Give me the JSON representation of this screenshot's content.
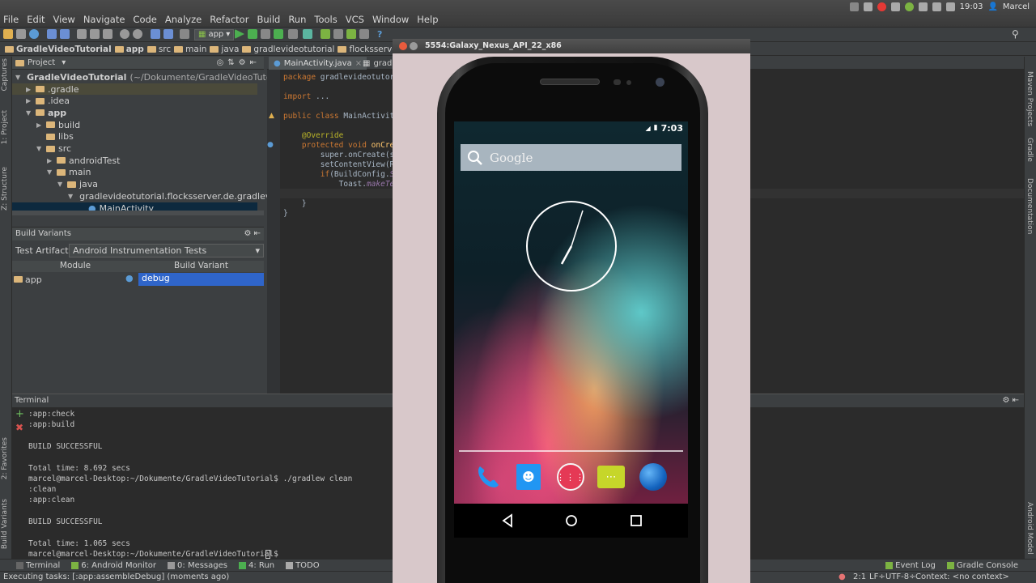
{
  "menu": {
    "items": [
      "File",
      "Edit",
      "View",
      "Navigate",
      "Code",
      "Analyze",
      "Refactor",
      "Build",
      "Run",
      "Tools",
      "VCS",
      "Window",
      "Help"
    ]
  },
  "tray": {
    "time": "19:03",
    "user": "Marcel"
  },
  "toolbar": {
    "run_config": "app"
  },
  "breadcrumbs": [
    "GradleVideoTutorial",
    "app",
    "src",
    "main",
    "java",
    "gradlevideotutorial",
    "flocksserver"
  ],
  "project": {
    "header": "Project",
    "tree": [
      {
        "label": "GradleVideoTutorial",
        "suffix": "(~/Dokumente/GradleVideoTutorial)",
        "depth": 0,
        "open": true
      },
      {
        "label": ".gradle",
        "depth": 1,
        "open": false
      },
      {
        "label": ".idea",
        "depth": 1,
        "open": false
      },
      {
        "label": "app",
        "depth": 1,
        "open": true
      },
      {
        "label": "build",
        "depth": 2,
        "open": false
      },
      {
        "label": "libs",
        "depth": 2,
        "open": null
      },
      {
        "label": "src",
        "depth": 2,
        "open": true
      },
      {
        "label": "androidTest",
        "depth": 3,
        "open": false
      },
      {
        "label": "main",
        "depth": 3,
        "open": true
      },
      {
        "label": "java",
        "depth": 4,
        "open": true
      },
      {
        "label": "gradlevideotutorial.flocksserver.de.gradlevid",
        "depth": 5,
        "open": true
      },
      {
        "label": "MainActivity",
        "depth": 6,
        "open": null
      }
    ]
  },
  "build_variants": {
    "header": "Build Variants",
    "artifact_label": "Test Artifact:",
    "artifact_value": "Android Instrumentation Tests",
    "col_module": "Module",
    "col_variant": "Build Variant",
    "row_module": "app",
    "row_variant": "debug"
  },
  "editor": {
    "tabs": [
      "MainActivity.java",
      "gradle"
    ],
    "lines": [
      {
        "kw": "package ",
        "rest": "gradlevideotutoria"
      },
      {
        "kw": "",
        "rest": ""
      },
      {
        "kw": "import ",
        "rest": "..."
      },
      {
        "kw": "",
        "rest": ""
      },
      {
        "kw": "public class ",
        "rest": "MainActivity"
      },
      {
        "kw": "",
        "rest": ""
      },
      {
        "ann": "    @Override"
      },
      {
        "kw": "    protected void ",
        "fn": "onCreat"
      },
      {
        "kw": "",
        "rest": "        super.onCreate(sav"
      },
      {
        "kw": "",
        "rest": "        setContentView(R."
      },
      {
        "kw": "        if",
        "rest": "(BuildConfig.",
        "it": "SHO"
      },
      {
        "kw": "",
        "rest": "            Toast.",
        "it2": "makeText"
      },
      {
        "kw": "",
        "rest": "        }"
      },
      {
        "kw": "",
        "rest": "    }"
      },
      {
        "kw": "",
        "rest": "}"
      }
    ]
  },
  "terminal": {
    "header": "Terminal",
    "lines": [
      ":app:check",
      ":app:build",
      "",
      "BUILD SUCCESSFUL",
      "",
      "Total time: 8.692 secs",
      "marcel@marcel-Desktop:~/Dokumente/GradleVideoTutorial$ ./gradlew clean",
      ":clean",
      ":app:clean",
      "",
      "BUILD SUCCESSFUL",
      "",
      "Total time: 1.065 secs",
      "marcel@marcel-Desktop:~/Dokumente/GradleVideoTutorial$ "
    ]
  },
  "bottom_tabs": [
    "Terminal",
    "6: Android Monitor",
    "0: Messages",
    "4: Run",
    "TODO"
  ],
  "bottom_right_tabs": [
    "Event Log",
    "Gradle Console"
  ],
  "status": {
    "left": "Executing tasks: [:app:assembleDebug] (moments ago)",
    "position": "2:1",
    "line_sep": "LF÷",
    "encoding": "UTF-8÷",
    "context": "Context: <no context>"
  },
  "left_vtabs": [
    "Captures",
    "1: Project",
    "Z: Structure",
    "2: Favorites",
    "Build Variants"
  ],
  "right_vtabs": [
    "Maven Projects",
    "Gradle",
    "Documentation",
    "Android Model"
  ],
  "emulator": {
    "title": "5554:Galaxy_Nexus_API_22_x86",
    "time": "7:03",
    "search_label": "Google",
    "dock": [
      "phone-app",
      "contacts-app",
      "app-drawer",
      "messaging-app",
      "browser-app"
    ],
    "colors": {
      "phone": "#1e88e5",
      "contacts": "#2196f3",
      "drawer": "#e53955",
      "messaging": "#c6d62a",
      "browser": "#1565c0"
    }
  }
}
